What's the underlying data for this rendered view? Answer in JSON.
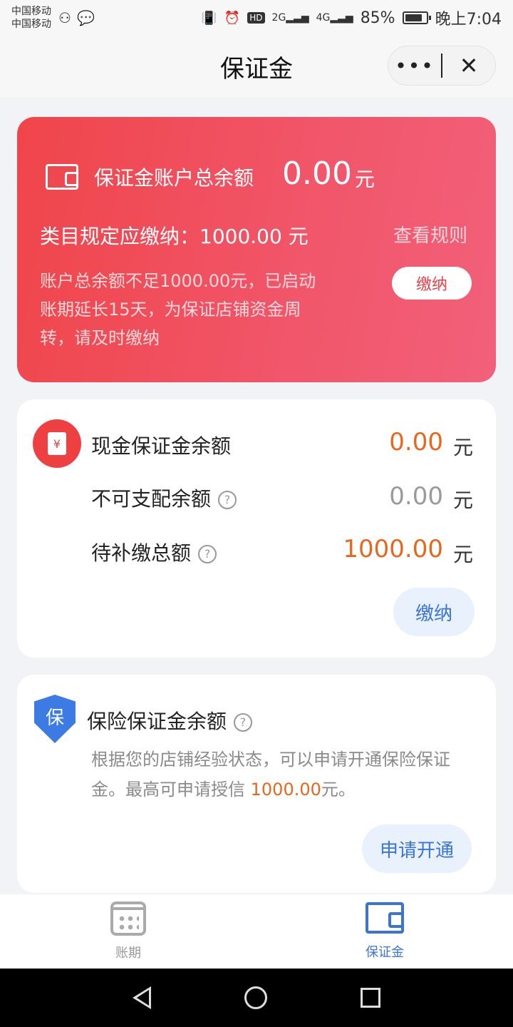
{
  "status_bar": {
    "carrier_1": "中国移动",
    "carrier_2": "中国移动",
    "battery_percent": "85%",
    "battery_level": 0.85,
    "network_1": "2G",
    "network_2": "4G",
    "hd": "HD",
    "time": "晚上7:04"
  },
  "header": {
    "title": "保证金",
    "more_icon": "more-icon",
    "close_icon": "close-icon"
  },
  "banner": {
    "total_label": "保证金账户总余额",
    "total_value": "0.00",
    "total_unit": "元",
    "required_text": "类目规定应缴纳：1000.00 元",
    "rules_link": "查看规则",
    "notice": "账户总余额不足1000.00元，已启动账期延长15天，为保证店铺资金周转，请及时缴纳",
    "pay_button": "缴纳"
  },
  "cash_card": {
    "title": "现金保证金余额",
    "title_value": "0.00",
    "unit": "元",
    "icon_glyph": "¥",
    "non_disposable_label": "不可支配余额",
    "non_disposable_value": "0.00",
    "pending_label": "待补缴总额",
    "pending_value": "1000.00",
    "help_glyph": "?",
    "pay_button": "缴纳"
  },
  "insurance_card": {
    "shield_glyph": "保",
    "title": "保险保证金余额",
    "desc_prefix": "根据您的店铺经验状态，可以申请开通保险保证金。最高可申请授信 ",
    "desc_amount": "1000.00",
    "desc_suffix": "元。",
    "apply_button": "申请开通"
  },
  "tabbar": {
    "tabs": [
      {
        "label": "账期",
        "icon": "calendar-icon",
        "active": false
      },
      {
        "label": "保证金",
        "icon": "wallet-icon",
        "active": true
      }
    ]
  },
  "colors": {
    "banner_red": "#f0454a",
    "accent_orange": "#e8671f",
    "accent_blue": "#3a74d8"
  }
}
